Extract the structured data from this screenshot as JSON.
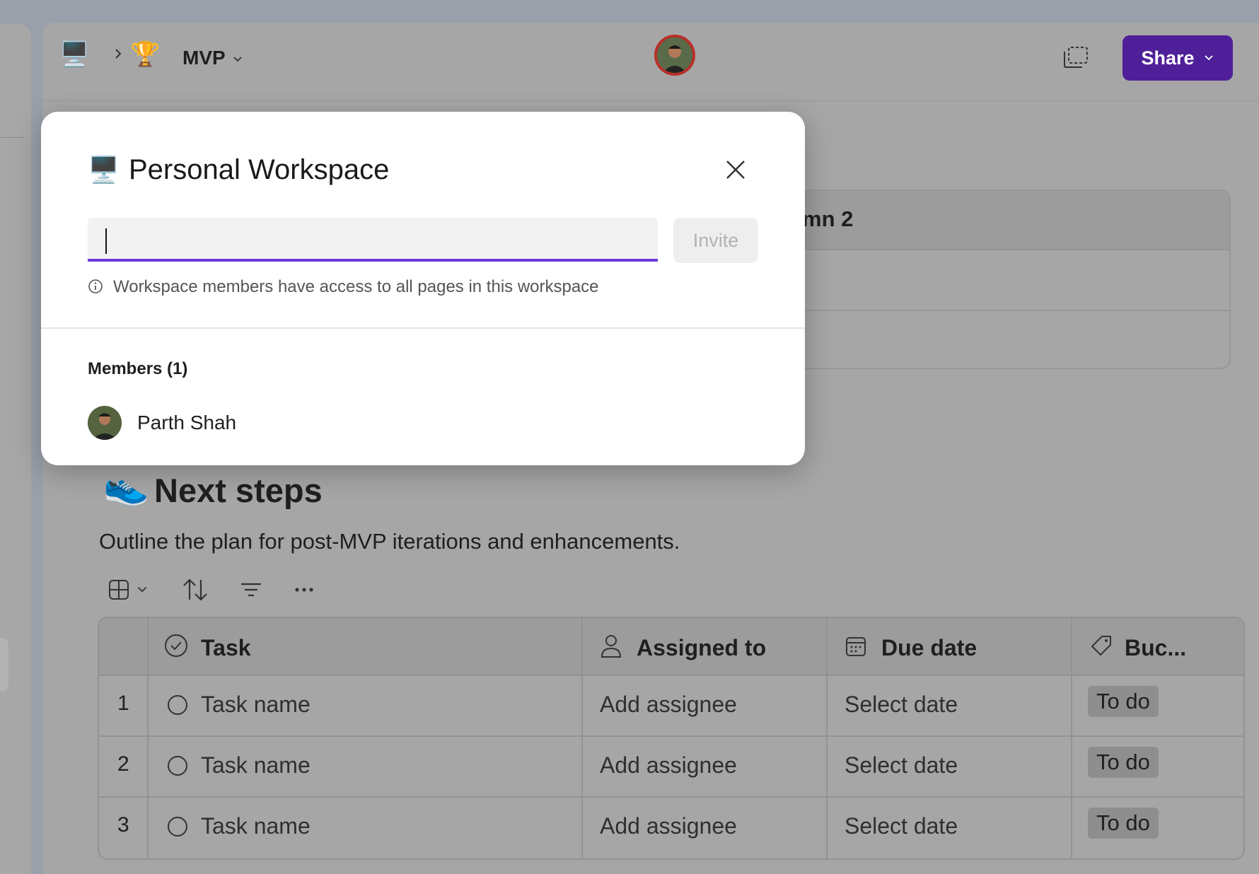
{
  "breadcrumb": {
    "workspace_icon": "desktop-computer-icon",
    "page_icon": "trophy-icon",
    "page_title": "MVP"
  },
  "topbar": {
    "share_label": "Share",
    "accent_color": "#4f1f99"
  },
  "background_table": {
    "header_partial": "mn 2"
  },
  "section": {
    "icon": "running-shoe-icon",
    "title": "Next steps",
    "description": "Outline the plan for post-MVP iterations and enhancements."
  },
  "task_table": {
    "columns": [
      {
        "label": "Task",
        "icon": "check-circle-icon"
      },
      {
        "label": "Assigned to",
        "icon": "person-icon"
      },
      {
        "label": "Due date",
        "icon": "calendar-icon"
      },
      {
        "label": "Buc...",
        "icon": "tag-icon"
      }
    ],
    "rows": [
      {
        "num": "1",
        "task": "Task name",
        "assignee": "Add assignee",
        "due": "Select date",
        "bucket": "To do"
      },
      {
        "num": "2",
        "task": "Task name",
        "assignee": "Add assignee",
        "due": "Select date",
        "bucket": "To do"
      },
      {
        "num": "3",
        "task": "Task name",
        "assignee": "Add assignee",
        "due": "Select date",
        "bucket": "To do"
      }
    ]
  },
  "modal": {
    "icon": "desktop-computer-icon",
    "title": "Personal Workspace",
    "input_value": "",
    "invite_label": "Invite",
    "info_text": "Workspace members have access to all pages in this workspace",
    "members_heading": "Members (1)",
    "members": [
      {
        "name": "Parth Shah"
      }
    ],
    "input_accent_color": "#6b3ad6"
  }
}
